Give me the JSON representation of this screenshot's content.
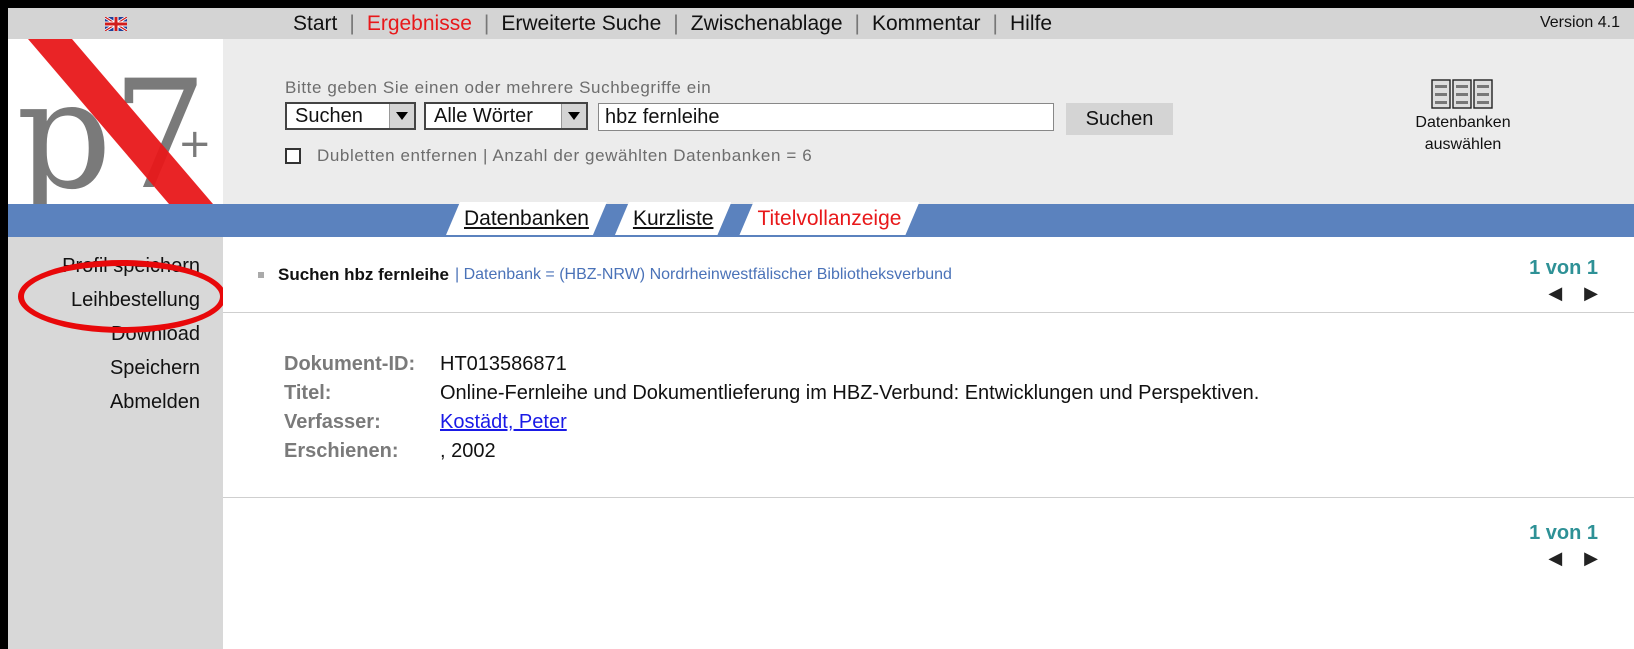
{
  "window": {
    "version": "Version 4.1"
  },
  "nav": {
    "items": [
      {
        "label": "Start",
        "active": false
      },
      {
        "label": "Ergebnisse",
        "active": true
      },
      {
        "label": "Erweiterte Suche",
        "active": false
      },
      {
        "label": "Zwischenablage",
        "active": false
      },
      {
        "label": "Kommentar",
        "active": false
      },
      {
        "label": "Hilfe",
        "active": false
      }
    ]
  },
  "search": {
    "prompt": "Bitte geben Sie einen oder mehrere Suchbegriffe ein",
    "type_select": "Suchen",
    "mode_select": "Alle Wörter",
    "query": "hbz fernleihe",
    "button": "Suchen",
    "dup_label": "Dubletten entfernen | Anzahl der gewählten Datenbanken = 6"
  },
  "db_select": {
    "line1": "Datenbanken",
    "line2": "auswählen"
  },
  "tabs": [
    {
      "label": "Datenbanken",
      "active": false
    },
    {
      "label": "Kurzliste",
      "active": false
    },
    {
      "label": "Titelvollanzeige",
      "active": true
    }
  ],
  "sidebar": {
    "items": [
      "Profil speichern",
      "Leihbestellung",
      "Download",
      "Speichern",
      "Abmelden"
    ]
  },
  "breadcrumb": {
    "query": "Suchen  hbz fernleihe",
    "database": "| Datenbank = (HBZ-NRW) Nordrheinwestfälischer Bibliotheksverbund"
  },
  "pager": {
    "text": "1 von 1",
    "prev": "◀",
    "next": "▶"
  },
  "record": {
    "id_label": "Dokument-ID:",
    "id": "HT013586871",
    "title_label": "Titel:",
    "title": "Online-Fernleihe und Dokumentlieferung im HBZ-Verbund: Entwicklungen und Perspektiven.",
    "author_label": "Verfasser:",
    "author": "Kostädt, Peter",
    "published_label": "Erschienen:",
    "published": ", 2002"
  },
  "logo": {
    "text": "p7",
    "plus": "+"
  },
  "colors": {
    "accent_red": "#e8181a",
    "bar_blue": "#5b82be",
    "pager_teal": "#2e9196",
    "link_blue": "#1a1ae6"
  },
  "icons": [
    "uk-flag-icon",
    "database-icon",
    "dropdown-arrow-icon",
    "prev-arrow-icon",
    "next-arrow-icon"
  ]
}
